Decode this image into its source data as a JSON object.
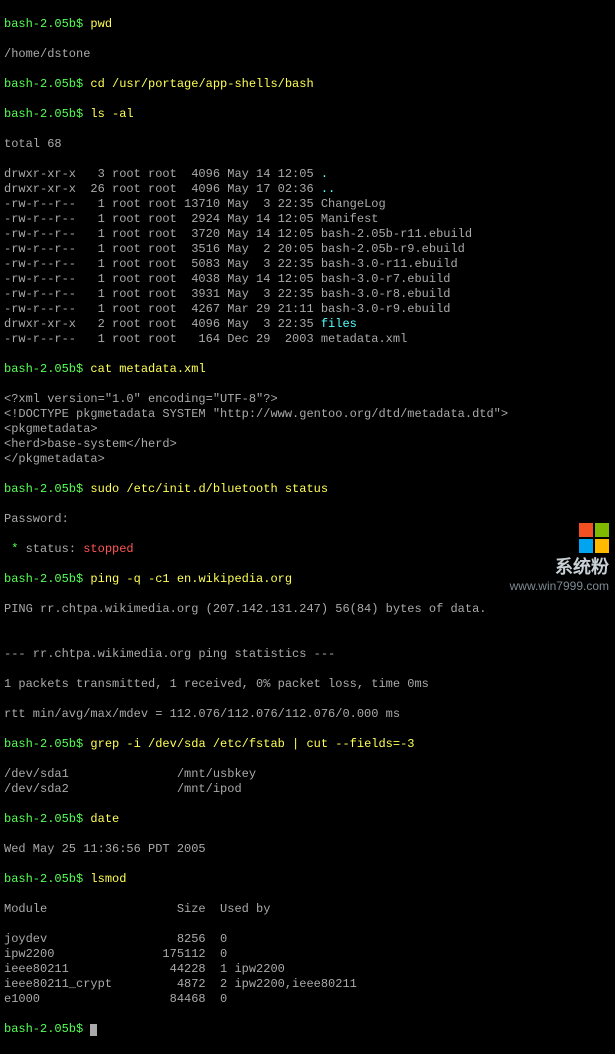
{
  "prompt": "bash-2.05b$",
  "cmds": {
    "pwd": "pwd",
    "cd": "cd /usr/portage/app-shells/bash",
    "ls": "ls -al",
    "cat": "cat metadata.xml",
    "sudo": "sudo /etc/init.d/bluetooth status",
    "ping": "ping -q -c1 en.wikipedia.org",
    "grep": "grep -i /dev/sda /etc/fstab | cut --fields=-3",
    "date": "date",
    "lsmod": "lsmod"
  },
  "pwd_out": "/home/dstone",
  "ls_total": "total 68",
  "ls": [
    {
      "l": "drwxr-xr-x   3 root root  4096 May 14 12:05 ",
      "name": ".",
      "cls": "brcyan"
    },
    {
      "l": "drwxr-xr-x  26 root root  4096 May 17 02:36 ",
      "name": "..",
      "cls": "brcyan"
    },
    {
      "l": "-rw-r--r--   1 root root 13710 May  3 22:35 ",
      "name": "ChangeLog",
      "cls": ""
    },
    {
      "l": "-rw-r--r--   1 root root  2924 May 14 12:05 ",
      "name": "Manifest",
      "cls": ""
    },
    {
      "l": "-rw-r--r--   1 root root  3720 May 14 12:05 ",
      "name": "bash-2.05b-r11.ebuild",
      "cls": ""
    },
    {
      "l": "-rw-r--r--   1 root root  3516 May  2 20:05 ",
      "name": "bash-2.05b-r9.ebuild",
      "cls": ""
    },
    {
      "l": "-rw-r--r--   1 root root  5083 May  3 22:35 ",
      "name": "bash-3.0-r11.ebuild",
      "cls": ""
    },
    {
      "l": "-rw-r--r--   1 root root  4038 May 14 12:05 ",
      "name": "bash-3.0-r7.ebuild",
      "cls": ""
    },
    {
      "l": "-rw-r--r--   1 root root  3931 May  3 22:35 ",
      "name": "bash-3.0-r8.ebuild",
      "cls": ""
    },
    {
      "l": "-rw-r--r--   1 root root  4267 Mar 29 21:11 ",
      "name": "bash-3.0-r9.ebuild",
      "cls": ""
    },
    {
      "l": "drwxr-xr-x   2 root root  4096 May  3 22:35 ",
      "name": "files",
      "cls": "brcyan"
    },
    {
      "l": "-rw-r--r--   1 root root   164 Dec 29  2003 ",
      "name": "metadata.xml",
      "cls": ""
    }
  ],
  "xml": [
    "<?xml version=\"1.0\" encoding=\"UTF-8\"?>",
    "<!DOCTYPE pkgmetadata SYSTEM \"http://www.gentoo.org/dtd/metadata.dtd\">",
    "<pkgmetadata>",
    "<herd>base-system</herd>",
    "</pkgmetadata>"
  ],
  "password_label": "Password:",
  "status": {
    "star": " * ",
    "label": "status: ",
    "value": "stopped"
  },
  "ping": {
    "header": "PING rr.chtpa.wikimedia.org (207.142.131.247) 56(84) bytes of data.",
    "blank": "",
    "stats_hdr": "--- rr.chtpa.wikimedia.org ping statistics ---",
    "stats1": "1 packets transmitted, 1 received, 0% packet loss, time 0ms",
    "stats2": "rtt min/avg/max/mdev = 112.076/112.076/112.076/0.000 ms"
  },
  "grep_out": [
    "/dev/sda1               /mnt/usbkey",
    "/dev/sda2               /mnt/ipod"
  ],
  "date_out": "Wed May 25 11:36:56 PDT 2005",
  "lsmod_hdr": "Module                  Size  Used by",
  "lsmod_rows": [
    "joydev                  8256  0",
    "ipw2200               175112  0",
    "ieee80211              44228  1 ipw2200",
    "ieee80211_crypt         4872  2 ipw2200,ieee80211",
    "e1000                  84468  0"
  ],
  "watermark": {
    "title": "系统粉",
    "url": "www.win7999.com"
  }
}
